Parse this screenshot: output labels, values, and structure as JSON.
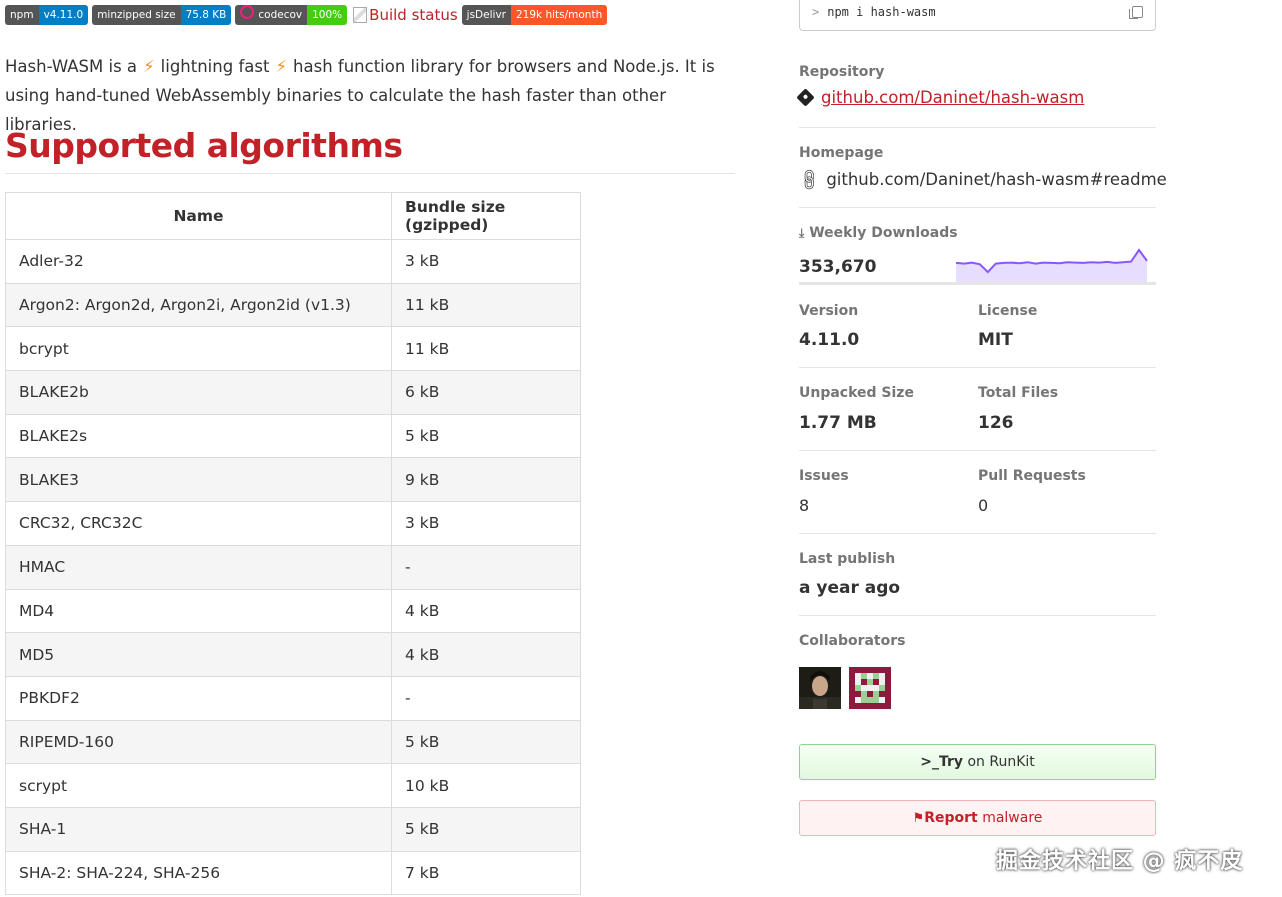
{
  "badges": {
    "npm": {
      "label": "npm",
      "value": "v4.11.0"
    },
    "size": {
      "label": "minzipped size",
      "value": "75.8 KB"
    },
    "codecov": {
      "label": "codecov",
      "value": "100%"
    },
    "build": {
      "alt": "Build status"
    },
    "jsdelivr": {
      "label": "jsDelivr",
      "value": "219k hits/month"
    }
  },
  "intro": {
    "part1": "Hash-WASM is a",
    "part2": "lightning fast",
    "part3": "hash function library for browsers and Node.js. It is using hand-tuned WebAssembly binaries to calculate the hash faster than other libraries."
  },
  "heading": "Supported algorithms",
  "table": {
    "headers": [
      "Name",
      "Bundle size (gzipped)"
    ],
    "rows": [
      [
        "Adler-32",
        "3 kB"
      ],
      [
        "Argon2: Argon2d, Argon2i, Argon2id (v1.3)",
        "11 kB"
      ],
      [
        "bcrypt",
        "11 kB"
      ],
      [
        "BLAKE2b",
        "6 kB"
      ],
      [
        "BLAKE2s",
        "5 kB"
      ],
      [
        "BLAKE3",
        "9 kB"
      ],
      [
        "CRC32, CRC32C",
        "3 kB"
      ],
      [
        "HMAC",
        "-"
      ],
      [
        "MD4",
        "4 kB"
      ],
      [
        "MD5",
        "4 kB"
      ],
      [
        "PBKDF2",
        "-"
      ],
      [
        "RIPEMD-160",
        "5 kB"
      ],
      [
        "scrypt",
        "10 kB"
      ],
      [
        "SHA-1",
        "5 kB"
      ],
      [
        "SHA-2: SHA-224, SHA-256",
        "7 kB"
      ]
    ]
  },
  "sidebar": {
    "install_prompt": ">",
    "install_cmd": "npm i hash-wasm",
    "repository_label": "Repository",
    "repository_link": "github.com/Daninet/hash-wasm",
    "homepage_label": "Homepage",
    "homepage_link": "github.com/Daninet/hash-wasm#readme",
    "downloads_label": "Weekly Downloads",
    "downloads_value": "353,670",
    "downloads_trend": [
      0.62,
      0.6,
      0.63,
      0.58,
      0.35,
      0.6,
      0.62,
      0.63,
      0.61,
      0.64,
      0.6,
      0.63,
      0.62,
      0.61,
      0.64,
      0.63,
      0.62,
      0.64,
      0.63,
      0.65,
      0.62,
      0.64,
      0.66,
      1.0,
      0.68
    ],
    "version_label": "Version",
    "version_value": "4.11.0",
    "license_label": "License",
    "license_value": "MIT",
    "unpacked_label": "Unpacked Size",
    "unpacked_value": "1.77 MB",
    "files_label": "Total Files",
    "files_value": "126",
    "issues_label": "Issues",
    "issues_value": "8",
    "prs_label": "Pull Requests",
    "prs_value": "0",
    "publish_label": "Last publish",
    "publish_value": "a year ago",
    "collaborators_label": "Collaborators",
    "runkit_prefix": ">_",
    "runkit_bold": "Try",
    "runkit_rest": "on RunKit",
    "malware_bold": "Report",
    "malware_rest": "malware"
  },
  "watermark": "掘金技术社区 @ 疯不皮",
  "colors": {
    "accent": "#c12127",
    "spark_line": "#8956ff",
    "spark_fill": "#e6ddff"
  }
}
